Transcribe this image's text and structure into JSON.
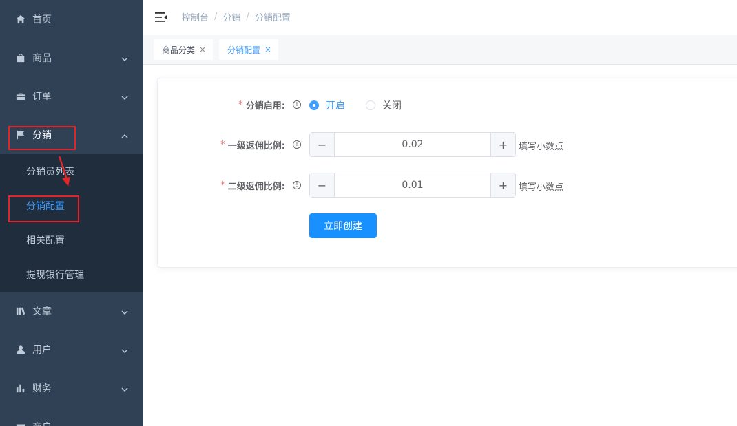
{
  "sidebar": {
    "items": [
      {
        "label": "首页",
        "icon": "home-icon"
      },
      {
        "label": "商品",
        "icon": "shopping-bag-icon"
      },
      {
        "label": "订单",
        "icon": "briefcase-icon"
      },
      {
        "label": "分销",
        "icon": "flag-icon"
      },
      {
        "label": "文章",
        "icon": "book-icon"
      },
      {
        "label": "用户",
        "icon": "user-icon"
      },
      {
        "label": "财务",
        "icon": "bar-chart-icon"
      },
      {
        "label": "商户",
        "icon": "store-icon"
      }
    ],
    "submenu": [
      {
        "label": "分销员列表"
      },
      {
        "label": "分销配置"
      },
      {
        "label": "相关配置"
      },
      {
        "label": "提现银行管理"
      }
    ]
  },
  "breadcrumb": [
    "控制台",
    "分销",
    "分销配置"
  ],
  "tags": [
    {
      "label": "商品分类",
      "close": "×"
    },
    {
      "label": "分销配置",
      "close": "×"
    }
  ],
  "form": {
    "enable": {
      "label": "分销启用:",
      "required": "*",
      "options": [
        {
          "label": "开启",
          "checked": true
        },
        {
          "label": "关闭",
          "checked": false
        }
      ]
    },
    "level1": {
      "label": "一级返佣比例:",
      "required": "*",
      "value": "0.02",
      "hint": "填写小数点"
    },
    "level2": {
      "label": "二级返佣比例:",
      "required": "*",
      "value": "0.01",
      "hint": "填写小数点"
    },
    "submit_label": "立即创建",
    "minus": "−",
    "plus": "+"
  },
  "colors": {
    "sidebar_bg": "#304156",
    "submenu_bg": "#1f2d3d",
    "accent": "#409eff",
    "button": "#1890ff",
    "highlight": "#e0262b"
  }
}
